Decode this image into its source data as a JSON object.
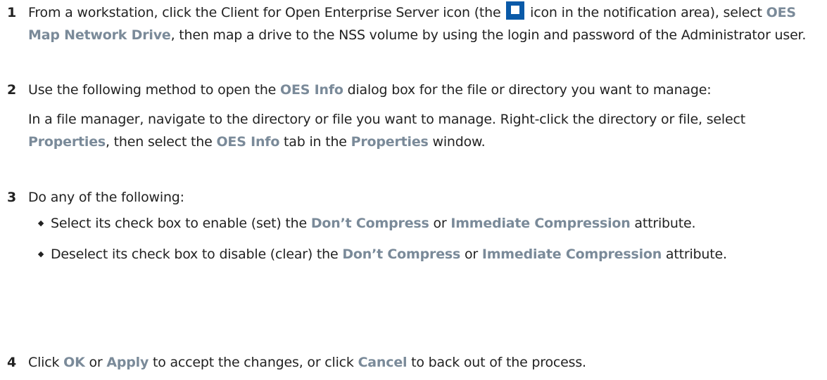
{
  "step1": {
    "number": "1",
    "t1": "From a workstation, click the Client for Open Enterprise Server icon (the",
    "icon_name": "oes-client-icon",
    "t2": " icon in the notification area), select ",
    "ui1": "OES Map Network Drive",
    "t3": ", then map a drive to the NSS volume by using the login and password of the Administrator user."
  },
  "step2": {
    "number": "2",
    "t1": "Use the following method to open the ",
    "ui1": "OES Info",
    "t2": " dialog box for the file or directory you want to manage:",
    "p2_t1": "In a file manager, navigate to the directory or file you want to manage. Right-click the directory or file, select ",
    "p2_ui1": "Properties",
    "p2_t2": ", then select the ",
    "p2_ui2": "OES Info",
    "p2_t3": " tab in the ",
    "p2_ui3": "Properties",
    "p2_t4": " window."
  },
  "step3": {
    "number": "3",
    "text": "Do any of the following:",
    "bullet_mark": "◆",
    "bullets": [
      {
        "t1": "Select its check box to enable (set) the ",
        "ui1": "Don’t Compress",
        "t2": " or ",
        "ui2": "Immediate Compression",
        "t3": " attribute."
      },
      {
        "t1": "Deselect its check box to disable (clear) the ",
        "ui1": "Don’t Compress",
        "t2": " or ",
        "ui2": "Immediate Compression",
        "t3": " attribute."
      }
    ]
  },
  "step4": {
    "number": "4",
    "t1": "Click ",
    "ui1": "OK",
    "t2": " or ",
    "ui2": "Apply",
    "t3": " to accept the changes, or click ",
    "ui3": "Cancel",
    "t4": " to back out of the process."
  },
  "colors": {
    "text": "#222222",
    "ui_label": "#7a8a99",
    "icon_blue": "#0a5aa8"
  }
}
